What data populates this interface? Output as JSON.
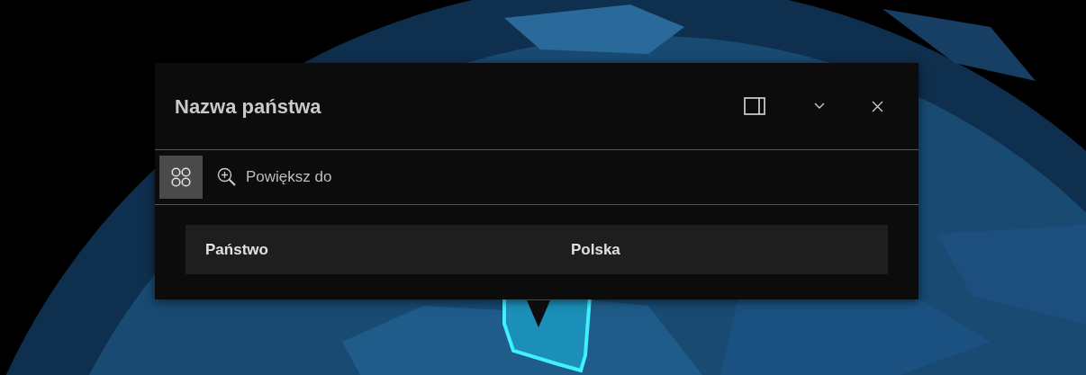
{
  "popup": {
    "title": "Nazwa państwa",
    "toolbar": {
      "menu_toggle": {
        "selected": true
      },
      "actions": [
        {
          "label": "Powiększ do"
        }
      ]
    },
    "fields": [
      {
        "label": "Państwo",
        "value": "Polska"
      }
    ]
  }
}
